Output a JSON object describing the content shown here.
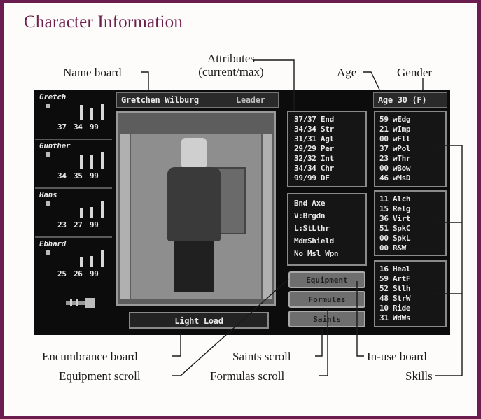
{
  "heading": "Character Information",
  "callouts": {
    "name_board": "Name board",
    "attributes": "Attributes",
    "attributes_sub": "(current/max)",
    "age": "Age",
    "gender": "Gender",
    "encumbrance": "Encumbrance board",
    "equipment": "Equipment scroll",
    "saints": "Saints scroll",
    "formulas": "Formulas scroll",
    "in_use": "In-use board",
    "skills": "Skills"
  },
  "party": [
    {
      "name": "Gretch",
      "stats": "37 34 99"
    },
    {
      "name": "Gunther",
      "stats": "34 35 99"
    },
    {
      "name": "Hans",
      "stats": "23 27 99"
    },
    {
      "name": "Ebhard",
      "stats": "25 26 99"
    }
  ],
  "character": {
    "name": "Gretchen Wilburg",
    "role": "Leader",
    "age_gender": "Age 30 (F)"
  },
  "attributes": [
    {
      "label": "37/37 End"
    },
    {
      "label": "34/34 Str"
    },
    {
      "label": "31/31 Agl"
    },
    {
      "label": "29/29 Per"
    },
    {
      "label": "32/32 Int"
    },
    {
      "label": "34/34 Chr"
    },
    {
      "label": "99/99 DF"
    }
  ],
  "in_use": [
    {
      "label": "Bnd Axe"
    },
    {
      "label": "V:Brgdn"
    },
    {
      "label": "L:StLthr"
    },
    {
      "label": "MdmShield"
    },
    {
      "label": "No Msl Wpn"
    }
  ],
  "skills_weapons": [
    {
      "label": "59 wEdg"
    },
    {
      "label": "21 wImp"
    },
    {
      "label": "00 wFll"
    },
    {
      "label": "37 wPol"
    },
    {
      "label": "23 wThr"
    },
    {
      "label": "00 wBow"
    },
    {
      "label": "46 wMsD"
    }
  ],
  "skills_lore": [
    {
      "label": "11 Alch"
    },
    {
      "label": "15 Relg"
    },
    {
      "label": "36 Virt"
    },
    {
      "label": "51 SpkC"
    },
    {
      "label": "00 SpkL"
    },
    {
      "label": "00 R&W"
    }
  ],
  "skills_other": [
    {
      "label": "16 Heal"
    },
    {
      "label": "59 ArtF"
    },
    {
      "label": "52 Stlh"
    },
    {
      "label": "48 StrW"
    },
    {
      "label": "10 Ride"
    },
    {
      "label": "31 WdWs"
    }
  ],
  "scrolls": {
    "equipment": "Equipment",
    "formulas": "Formulas",
    "saints": "Saints"
  },
  "encumbrance": "Light Load",
  "colors": {
    "frame": "#6a1d4e",
    "heading": "#6b1f4d",
    "screen_bg": "#0c0c0c"
  }
}
